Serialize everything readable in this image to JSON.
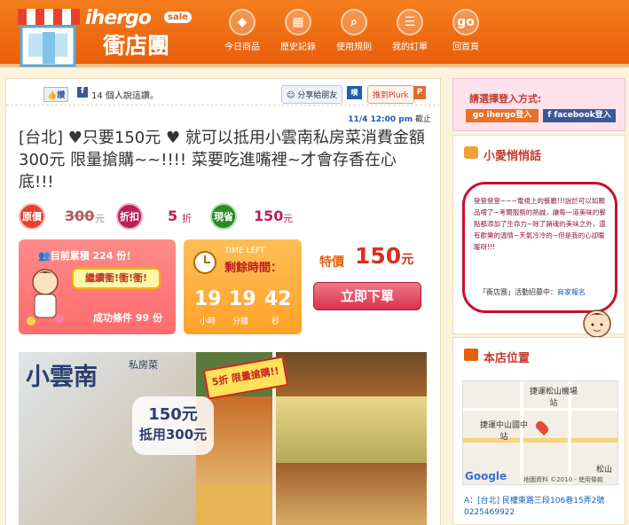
{
  "header": {
    "brand": "ihergo",
    "sale": "sale",
    "title": "衝店團",
    "nav": [
      {
        "label": "今日商品",
        "icon": "tag-icon",
        "glyph": "◆"
      },
      {
        "label": "歷史記錄",
        "icon": "calendar-icon",
        "glyph": "▦"
      },
      {
        "label": "使用規則",
        "icon": "search-icon",
        "glyph": "⌕"
      },
      {
        "label": "我的訂單",
        "icon": "chat-icon",
        "glyph": "☰"
      },
      {
        "label": "回首頁",
        "icon": "go-icon",
        "glyph": "go"
      }
    ]
  },
  "share": {
    "like": "讚",
    "likes_text": "14 個人說這讚。",
    "share_fb": "分享給朋友",
    "share_plurk": "推到Plurk"
  },
  "deal": {
    "deadline_time": "11/4  12:00 pm",
    "deadline_label": "截止",
    "title": "[台北] ♥只要150元 ♥ 就可以抵用小雲南私房菜消費金額300元 限量搶購~~!!!! 菜要吃進嘴裡~才會存香在心底!!!",
    "orig_label": "原價",
    "orig_price": "300",
    "disc_label": "折扣",
    "disc_value": "5",
    "save_label": "現省",
    "save_value": "150",
    "unit_yuan": "元",
    "unit_zhe": "折"
  },
  "status": {
    "count_text": "目前累積 224 份！",
    "cheer": "繼續衝!衝!衝!",
    "success_text": "成功條件 99 份",
    "time_left_en": "TIME LEFT",
    "time_left": "剩餘時間：",
    "hours": "19",
    "minutes": "19",
    "seconds": "42",
    "hours_label": "小時",
    "minutes_label": "分鐘",
    "seconds_label": "秒",
    "special_label": "特價",
    "special_price": "150",
    "buy_button": "立即下單"
  },
  "photo": {
    "brand": "小雲南",
    "sub": "私房菜",
    "promo": "5折 限量搶購!!",
    "price_line1": "150元",
    "price_line2": "抵用300元"
  },
  "sidebar": {
    "login_title": "請選擇登入方式:",
    "login_ihergo": "ihergo登入",
    "login_facebook": "facebook登入",
    "tips_title": "小愛悄悄話",
    "tips_text": "登登登登~~~電視上的餐廳!!!說於可以如願品嚐了~考爾服務的熱誠，讓每一道美味的餐點都添加了生命力~除了銷魂的美味之外，還有歡樂的溫情~天氣冷冷的~但是我的心卻暖暖呀!!!",
    "recruit_text": "「衝店團」活動招募中：",
    "recruit_link": "商家報名",
    "location_title": "本店位置",
    "map_labels": [
      "捷運松山機場站",
      "捷運中山國中站",
      "松山"
    ],
    "map_google": "Google",
    "map_footer": "地圖資料 ©2010 - 使用條款",
    "address": "A：[台北] 民權東路三段106巷15弄2號",
    "phone": "0225469922"
  },
  "colors": {
    "header": "#e85f0b",
    "accent_red": "#d8301f",
    "orig_badge": "#e8402c",
    "disc_badge": "#b8205a",
    "save_badge": "#2e8a25",
    "box_pink": "#ff6b6b",
    "box_orange": "#ffa229"
  }
}
